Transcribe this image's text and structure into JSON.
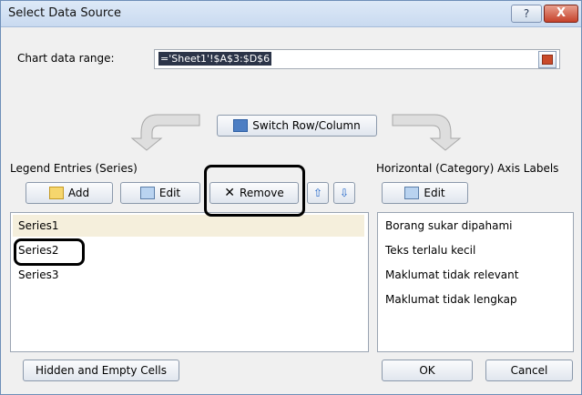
{
  "window": {
    "title": "Select Data Source",
    "help_label": "?",
    "close_label": "X"
  },
  "chart_range": {
    "label": "Chart data range:",
    "value": "='Sheet1'!$A$3:$D$6"
  },
  "switch_button": {
    "label": "Switch Row/Column"
  },
  "legend": {
    "label": "Legend Entries (Series)",
    "add_label": "Add",
    "edit_label": "Edit",
    "remove_label": "Remove",
    "up_label": "⇧",
    "down_label": "⇩",
    "items": [
      "Series1",
      "Series2",
      "Series3"
    ],
    "selected_index": 0
  },
  "axis": {
    "label": "Horizontal (Category) Axis Labels",
    "edit_label": "Edit",
    "items": [
      "Borang sukar dipahami",
      "Teks terlalu kecil",
      "Maklumat tidak relevant",
      "Maklumat tidak lengkap"
    ]
  },
  "footer": {
    "hidden_label": "Hidden and Empty Cells",
    "ok_label": "OK",
    "cancel_label": "Cancel"
  },
  "colors": {
    "title_bg": "#c9daf0",
    "range_highlight": "#2b3448",
    "selected_row": "#f5efdc",
    "close_button": "#c6422b"
  }
}
